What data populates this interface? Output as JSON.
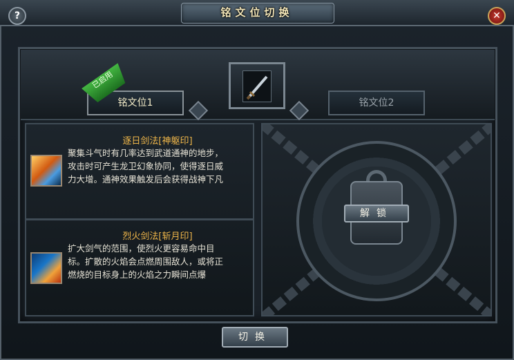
{
  "window": {
    "title": "铭文位切换",
    "help_icon": "question-icon",
    "close_icon": "close-icon"
  },
  "tabs": [
    {
      "label": "铭文位1",
      "active": true,
      "badge": "已启用"
    },
    {
      "label": "铭文位2",
      "active": false
    }
  ],
  "center_icon": "sword-icon",
  "skills": [
    {
      "name": "逐日剑法[神躯印]",
      "desc_lines": [
        "聚集斗气时有几率达到武道通神的地步，",
        "攻击时可产生龙卫幻象协同，使得逐日威",
        "力大增。通神效果触发后会获得战神下凡"
      ],
      "icon": "sun-sword-skill-icon"
    },
    {
      "name": "烈火剑法[斩月印]",
      "desc_lines": [
        "扩大剑气的范围，使烈火更容易命中目",
        "标。扩散的火焰会点燃周围敌人，或将正",
        "燃烧的目标身上的火焰之力瞬间点爆"
      ],
      "icon": "flame-sword-skill-icon"
    }
  ],
  "locked_slot": {
    "unlock_label": "解锁",
    "lock_icon": "padlock-icon"
  },
  "footer": {
    "switch_label": "切换"
  },
  "colors": {
    "skill_name": "#f2b84a",
    "enabled_badge": "#3aa83a",
    "title_text": "#f3e6b8"
  }
}
